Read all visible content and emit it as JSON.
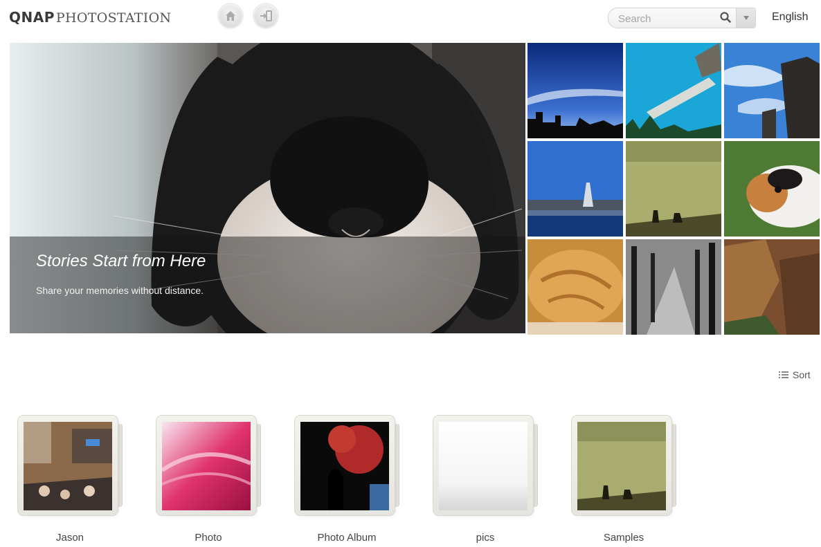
{
  "header": {
    "logo_brand": "QNAP",
    "logo_product": "PHOTOSTATION",
    "search_placeholder": "Search",
    "language": "English",
    "icons": [
      "home-icon",
      "login-icon",
      "search-icon",
      "dropdown-arrow-icon"
    ]
  },
  "hero": {
    "title": "Stories Start from Here",
    "subtitle": "Share your memories without distance."
  },
  "thumbnails": [
    {
      "subject": "sky-silhouette"
    },
    {
      "subject": "cyan-sky-plane"
    },
    {
      "subject": "skyscraper-clouds"
    },
    {
      "subject": "harbor-boats"
    },
    {
      "subject": "green-haze-figures"
    },
    {
      "subject": "guinea-pig"
    },
    {
      "subject": "sleeping-cat"
    },
    {
      "subject": "tree-avenue"
    },
    {
      "subject": "canyon-rocks"
    }
  ],
  "sort_label": "Sort",
  "albums": [
    {
      "name": "Jason"
    },
    {
      "name": "Photo"
    },
    {
      "name": "Photo Album"
    },
    {
      "name": "pics"
    },
    {
      "name": "Samples"
    }
  ],
  "colors": {
    "caption_band": "#141414",
    "text_primary": "#333333",
    "frame": "#e6e5df"
  }
}
